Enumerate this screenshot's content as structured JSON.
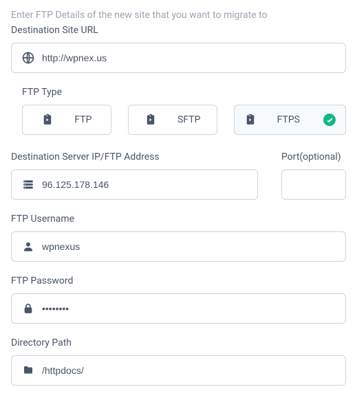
{
  "instruction": "Enter FTP Details of the new site that you want to migrate to",
  "dest_url": {
    "label": "Destination Site URL",
    "value": "http://wpnex.us"
  },
  "ftp_type": {
    "label": "FTP Type",
    "options": [
      "FTP",
      "SFTP",
      "FTPS"
    ],
    "selected": "FTPS"
  },
  "server_ip": {
    "label": "Destination Server IP/FTP Address",
    "value": "96.125.178.146"
  },
  "port": {
    "label": "Port(optional)",
    "value": ""
  },
  "username": {
    "label": "FTP Username",
    "value": "wpnexus"
  },
  "password": {
    "label": "FTP Password",
    "value": "••••••••"
  },
  "directory": {
    "label": "Directory Path",
    "value": "/httpdocs/"
  }
}
